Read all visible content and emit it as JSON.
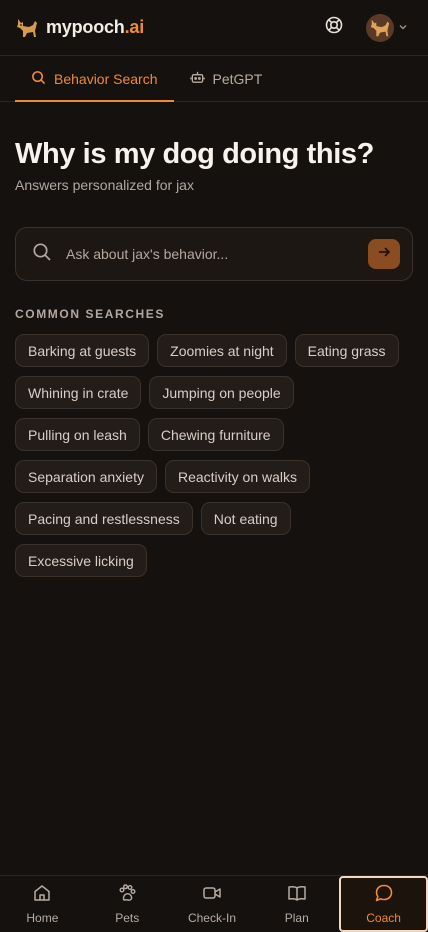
{
  "brand": {
    "name_main": "mypooch",
    "name_accent": ".ai"
  },
  "tabs": [
    {
      "label": "Behavior Search",
      "icon": "search-icon",
      "active": true
    },
    {
      "label": "PetGPT",
      "icon": "robot-icon",
      "active": false
    }
  ],
  "main": {
    "title": "Why is my dog doing this?",
    "subtitle": "Answers personalized for jax"
  },
  "search": {
    "placeholder": "Ask about jax's behavior..."
  },
  "common_searches": {
    "label": "COMMON SEARCHES",
    "items": [
      "Barking at guests",
      "Zoomies at night",
      "Eating grass",
      "Whining in crate",
      "Jumping on people",
      "Pulling on leash",
      "Chewing furniture",
      "Separation anxiety",
      "Reactivity on walks",
      "Pacing and restlessness",
      "Not eating",
      "Excessive licking"
    ]
  },
  "bottom_nav": [
    {
      "label": "Home",
      "icon": "home-icon",
      "active": false
    },
    {
      "label": "Pets",
      "icon": "paw-icon",
      "active": false
    },
    {
      "label": "Check-In",
      "icon": "video-icon",
      "active": false
    },
    {
      "label": "Plan",
      "icon": "book-icon",
      "active": false
    },
    {
      "label": "Coach",
      "icon": "chat-icon",
      "active": true
    }
  ],
  "colors": {
    "accent": "#f08a34",
    "background": "#15110e"
  }
}
